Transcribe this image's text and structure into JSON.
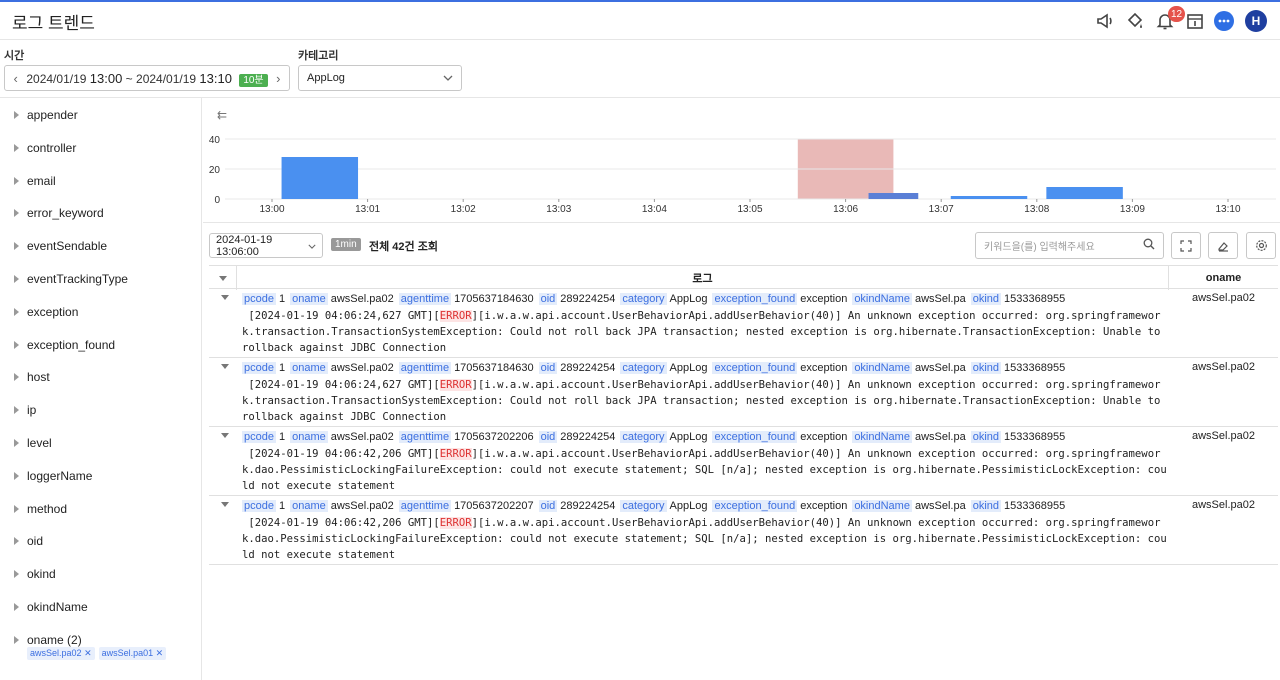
{
  "header": {
    "title": "로그 트렌드",
    "notification_count": "12",
    "avatar_letter": "H"
  },
  "filters": {
    "time_label": "시간",
    "time_start_date": "2024/01/19",
    "time_start_hm": "13:00",
    "time_sep": "~",
    "time_end_date": "2024/01/19",
    "time_end_hm": "13:10",
    "duration": "10분",
    "category_label": "카테고리",
    "category_value": "AppLog"
  },
  "sidebar": {
    "items": [
      {
        "label": "appender"
      },
      {
        "label": "controller"
      },
      {
        "label": "email"
      },
      {
        "label": "error_keyword"
      },
      {
        "label": "eventSendable"
      },
      {
        "label": "eventTrackingType"
      },
      {
        "label": "exception"
      },
      {
        "label": "exception_found"
      },
      {
        "label": "host"
      },
      {
        "label": "ip"
      },
      {
        "label": "level"
      },
      {
        "label": "loggerName"
      },
      {
        "label": "method"
      },
      {
        "label": "oid"
      },
      {
        "label": "okind"
      },
      {
        "label": "okindName"
      },
      {
        "label": "oname (2)"
      }
    ],
    "oname_chips": [
      "awsSel.pa02",
      "awsSel.pa01"
    ]
  },
  "chart_data": {
    "type": "bar",
    "categories": [
      "13:00",
      "13:01",
      "13:02",
      "13:03",
      "13:04",
      "13:05",
      "13:06",
      "13:07",
      "13:08",
      "13:09",
      "13:10"
    ],
    "values": [
      28,
      0,
      0,
      0,
      0,
      0,
      4,
      2,
      8,
      0
    ],
    "ylim": [
      0,
      40
    ],
    "yticks": [
      "40",
      "20",
      "0"
    ],
    "highlighted_category": "13:06",
    "bar_color": "#4a90f0",
    "highlight_color": "#e9b9b7",
    "grid": true
  },
  "toolbar": {
    "date_select": "2024-01-19 13:06:00",
    "interval": "1min",
    "total_text": "전체 42건 조회",
    "search_placeholder": "키워드을(를) 입력해주세요"
  },
  "table": {
    "col_log": "로그",
    "col_oname": "oname",
    "rows": [
      {
        "fields": [
          {
            "k": "pcode",
            "v": "1"
          },
          {
            "k": "oname",
            "v": "awsSel.pa02"
          },
          {
            "k": "agenttime",
            "v": "1705637184630"
          },
          {
            "k": "oid",
            "v": "289224254"
          },
          {
            "k": "category",
            "v": "AppLog"
          },
          {
            "k": "exception_found",
            "v": "exception"
          },
          {
            "k": "okindName",
            "v": "awsSel.pa"
          },
          {
            "k": "okind",
            "v": "1533368955"
          }
        ],
        "msg_prefix": " [2024-01-19 04:06:24,627 GMT][",
        "msg_level": "ERROR",
        "msg_suffix": "][i.w.a.w.api.account.UserBehaviorApi.addUserBehavior(40)] An unknown exception occurred: org.springframework.transaction.TransactionSystemException: Could not roll back JPA transaction; nested exception is org.hibernate.TransactionException: Unable to rollback against JDBC Connection",
        "oname": "awsSel.pa02"
      },
      {
        "fields": [
          {
            "k": "pcode",
            "v": "1"
          },
          {
            "k": "oname",
            "v": "awsSel.pa02"
          },
          {
            "k": "agenttime",
            "v": "1705637184630"
          },
          {
            "k": "oid",
            "v": "289224254"
          },
          {
            "k": "category",
            "v": "AppLog"
          },
          {
            "k": "exception_found",
            "v": "exception"
          },
          {
            "k": "okindName",
            "v": "awsSel.pa"
          },
          {
            "k": "okind",
            "v": "1533368955"
          }
        ],
        "msg_prefix": " [2024-01-19 04:06:24,627 GMT][",
        "msg_level": "ERROR",
        "msg_suffix": "][i.w.a.w.api.account.UserBehaviorApi.addUserBehavior(40)] An unknown exception occurred: org.springframework.transaction.TransactionSystemException: Could not roll back JPA transaction; nested exception is org.hibernate.TransactionException: Unable to rollback against JDBC Connection",
        "oname": "awsSel.pa02"
      },
      {
        "fields": [
          {
            "k": "pcode",
            "v": "1"
          },
          {
            "k": "oname",
            "v": "awsSel.pa02"
          },
          {
            "k": "agenttime",
            "v": "1705637202206"
          },
          {
            "k": "oid",
            "v": "289224254"
          },
          {
            "k": "category",
            "v": "AppLog"
          },
          {
            "k": "exception_found",
            "v": "exception"
          },
          {
            "k": "okindName",
            "v": "awsSel.pa"
          },
          {
            "k": "okind",
            "v": "1533368955"
          }
        ],
        "msg_prefix": " [2024-01-19 04:06:42,206 GMT][",
        "msg_level": "ERROR",
        "msg_suffix": "][i.w.a.w.api.account.UserBehaviorApi.addUserBehavior(40)] An unknown exception occurred: org.springframework.dao.PessimisticLockingFailureException: could not execute statement; SQL [n/a]; nested exception is org.hibernate.PessimisticLockException: could not execute statement",
        "oname": "awsSel.pa02"
      },
      {
        "fields": [
          {
            "k": "pcode",
            "v": "1"
          },
          {
            "k": "oname",
            "v": "awsSel.pa02"
          },
          {
            "k": "agenttime",
            "v": "1705637202207"
          },
          {
            "k": "oid",
            "v": "289224254"
          },
          {
            "k": "category",
            "v": "AppLog"
          },
          {
            "k": "exception_found",
            "v": "exception"
          },
          {
            "k": "okindName",
            "v": "awsSel.pa"
          },
          {
            "k": "okind",
            "v": "1533368955"
          }
        ],
        "msg_prefix": " [2024-01-19 04:06:42,206 GMT][",
        "msg_level": "ERROR",
        "msg_suffix": "][i.w.a.w.api.account.UserBehaviorApi.addUserBehavior(40)] An unknown exception occurred: org.springframework.dao.PessimisticLockingFailureException: could not execute statement; SQL [n/a]; nested exception is org.hibernate.PessimisticLockException: could not execute statement",
        "oname": "awsSel.pa02"
      }
    ]
  }
}
